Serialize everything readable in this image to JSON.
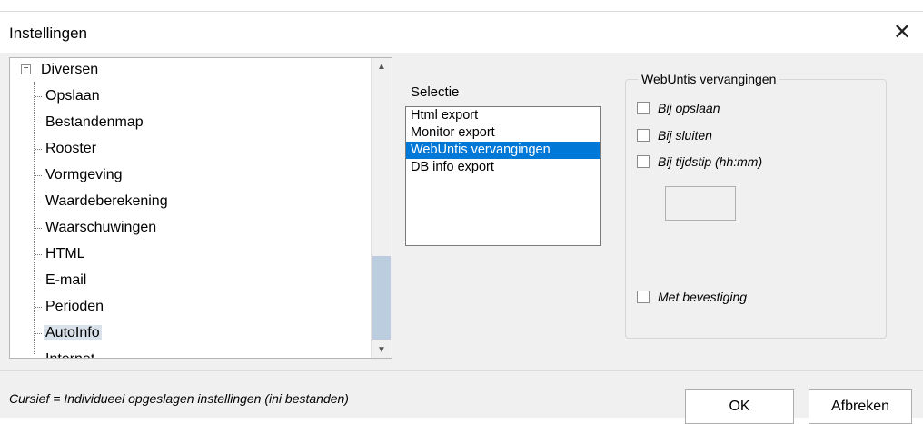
{
  "window": {
    "title": "Instellingen",
    "close_glyph": "✕"
  },
  "tree": {
    "root": {
      "label": "Diversen",
      "expander": "−"
    },
    "items": [
      {
        "label": "Opslaan"
      },
      {
        "label": "Bestandenmap"
      },
      {
        "label": "Rooster"
      },
      {
        "label": "Vormgeving"
      },
      {
        "label": "Waardeberekening"
      },
      {
        "label": "Waarschuwingen"
      },
      {
        "label": "HTML"
      },
      {
        "label": "E-mail"
      },
      {
        "label": "Perioden"
      },
      {
        "label": "AutoInfo",
        "selected": true
      },
      {
        "label": "Internet"
      }
    ]
  },
  "selectie": {
    "label": "Selectie",
    "items": [
      "Html export",
      "Monitor export",
      "WebUntis vervangingen",
      "DB info export"
    ],
    "selected": "WebUntis vervangingen"
  },
  "webuntis": {
    "group_title": "WebUntis vervangingen",
    "checkboxes": {
      "bij_opslaan": "Bij opslaan",
      "bij_sluiten": "Bij sluiten",
      "bij_tijdstip": "Bij tijdstip (hh:mm)",
      "met_bevestiging": "Met bevestiging"
    },
    "time_value": ""
  },
  "footer": {
    "note": "Cursief = Individueel opgeslagen instellingen (ini bestanden)",
    "ok_label": "OK",
    "cancel_label": "Afbreken"
  },
  "colors": {
    "selection": "#0078d7",
    "tree_selected": "#d9e1ea",
    "thumb": "#bccde0"
  }
}
